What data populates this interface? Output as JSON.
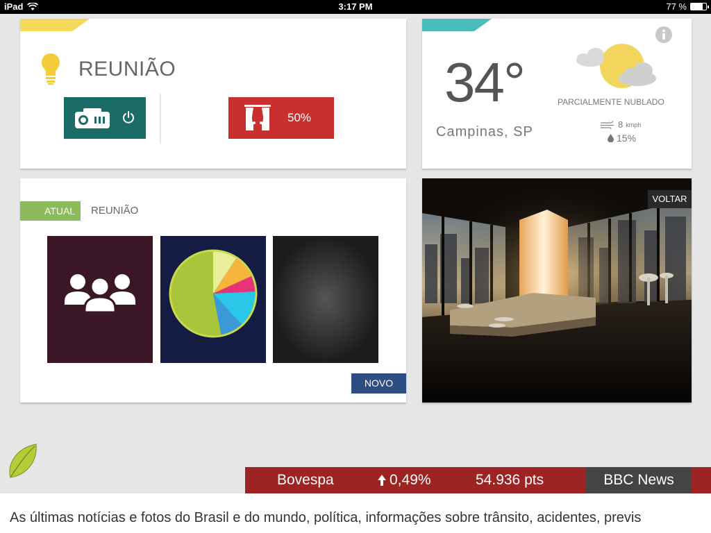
{
  "status_bar": {
    "device": "iPad",
    "time": "3:17 PM",
    "battery": "77 %",
    "battery_level": 0.77
  },
  "room_card": {
    "title": "REUNIÃO",
    "accent_color": "#f5d85a",
    "projector_icon": "projector-icon",
    "power_icon": "power-icon",
    "curtain_icon": "curtain-icon",
    "curtain_level": "50%"
  },
  "weather_card": {
    "accent_color": "#4bbcbc",
    "temperature": "34°",
    "city": "Campinas, SP",
    "condition": "PARCIALMENTE NUBLADO",
    "wind_value": "8",
    "wind_unit": "kmph",
    "humidity": "15%",
    "weather_icon": "partly-cloudy-icon"
  },
  "scenes_card": {
    "current_badge": "ATUAL",
    "current_scene": "REUNIÃO",
    "tiles": [
      {
        "icon": "people-group-icon",
        "color": "#3a1626"
      },
      {
        "icon": "pie-chart-icon",
        "color": "#141c44"
      },
      {
        "icon": "moon-icon",
        "color": "#1c1c1c"
      }
    ],
    "new_button": "NOVO"
  },
  "photo_card": {
    "back_button": "VOLTAR"
  },
  "ticker": {
    "index_name": "Bovespa",
    "change": "0,49%",
    "points": "54.936 pts",
    "news_source": "BBC News"
  },
  "news": {
    "headline": "As últimas notícias e fotos do Brasil e do mundo, política, informações sobre trânsito, acidentes, previs"
  }
}
